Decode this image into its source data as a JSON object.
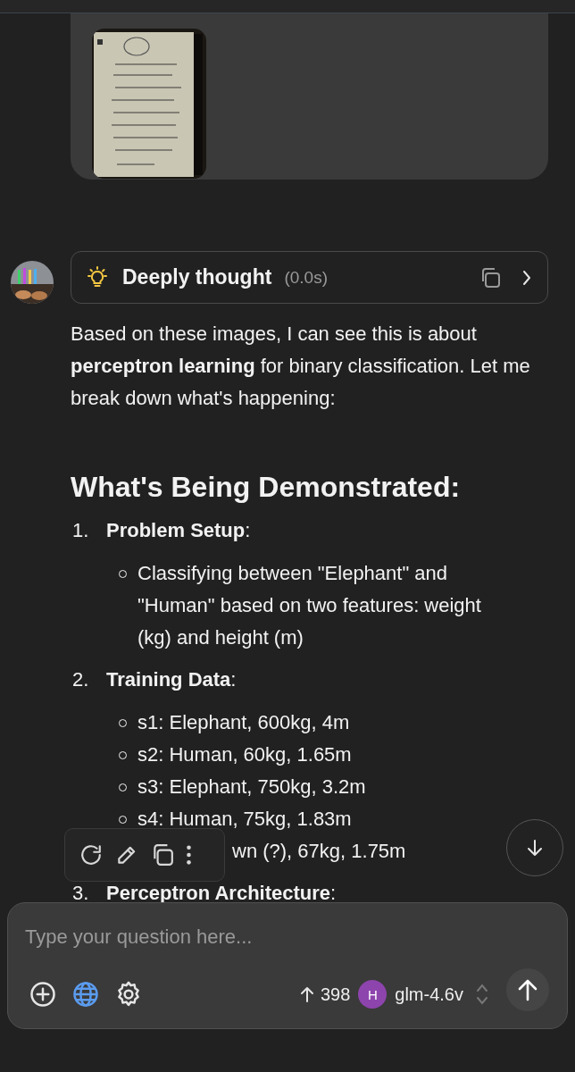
{
  "assistant": {
    "thought": {
      "label": "Deeply thought",
      "duration": "(0.0s)",
      "expanded": false
    },
    "paragraph": "Based on these images, I can see this is about **perceptron learning** for binary classification. Let me break down what's happening:",
    "heading": "What's Being Demonstrated:",
    "sections": [
      {
        "number": "1.",
        "title": "**Problem Setup**:",
        "items": [
          {
            "kind": "full",
            "text": "Classifying between \"Elephant\" and \"Human\" based on two features: weight (kg) and height (m)"
          }
        ]
      },
      {
        "number": "2.",
        "title": "**Training Data**:",
        "items": [
          {
            "kind": "full",
            "text": "s1: Elephant, 600kg, 4m"
          },
          {
            "kind": "full",
            "text": "s2: Human, 60kg, 1.65m"
          },
          {
            "kind": "full",
            "text": "s3: Elephant, 750kg, 3.2m"
          },
          {
            "kind": "full",
            "text": "s4: Human, 75kg, 1.83m"
          },
          {
            "kind": "partial",
            "text": "wn (?), 67kg, 1.75m"
          }
        ]
      },
      {
        "number": "3.",
        "title": "**Perceptron Architecture**:"
      }
    ]
  },
  "composer": {
    "placeholder": "Type your question here...",
    "token_count": "398",
    "model_badge": "H",
    "model": "glm-4.6v"
  }
}
